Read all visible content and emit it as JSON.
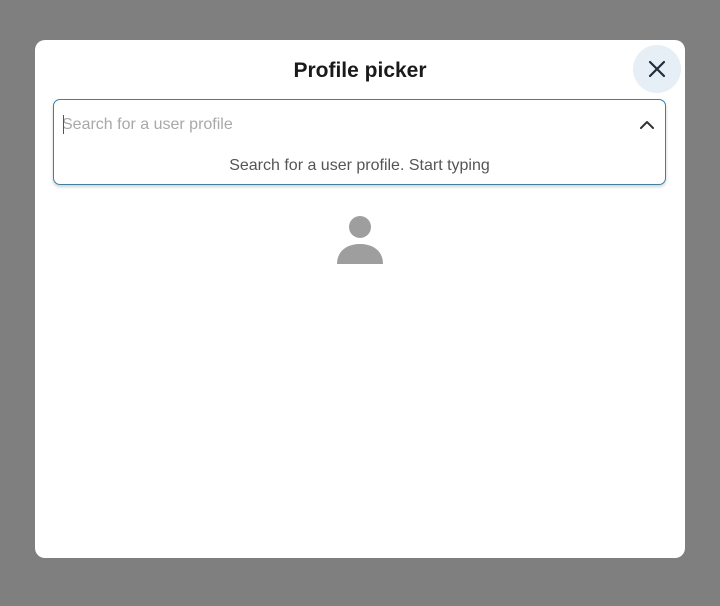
{
  "dialog": {
    "title": "Profile picker",
    "close_icon": "close-icon"
  },
  "search": {
    "placeholder": "Search for a user profile",
    "value": "",
    "toggle_icon": "chevron-up-icon",
    "hint": "Search for a user profile. Start typing"
  },
  "profile": {
    "avatar_icon": "person-icon"
  },
  "colors": {
    "backdrop": "#7f7f7f",
    "dialog_bg": "#ffffff",
    "accent_border": "#3f7fa6",
    "close_button_bg": "#e6eef6",
    "avatar": "#9e9e9e"
  }
}
